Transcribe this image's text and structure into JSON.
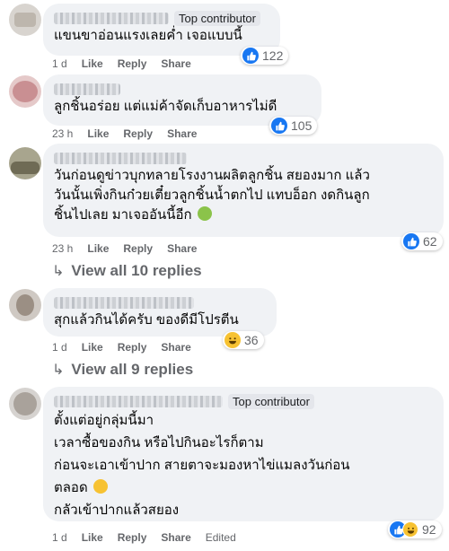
{
  "comments": [
    {
      "badge": "Top contributor",
      "lines": [
        "แขนขาอ่อนแรงเลยค่ำ เจอแบบนี้"
      ],
      "time": "1 d",
      "like": "Like",
      "reply": "Reply",
      "share": "Share",
      "count": "122",
      "reactions": [
        "like"
      ]
    },
    {
      "lines": [
        "ลูกชิ้นอร่อย แต่แม่ค้าจัดเก็บอาหารไม่ดี"
      ],
      "time": "23 h",
      "like": "Like",
      "reply": "Reply",
      "share": "Share",
      "count": "105",
      "reactions": [
        "like"
      ]
    },
    {
      "lines": [
        "วันก่อนดูข่าวบุกทลายโรงงานผลิตลูกชิ้น สยองมาก แล้ว",
        "วันนั้นเพิ่งกินก๋วยเตี๋ยวลูกชิ้นน้ำตกไป แทบอ็อก งดกินลูก",
        "ชิ้นไปเลย มาเจออันนี้อีก"
      ],
      "time": "23 h",
      "like": "Like",
      "reply": "Reply",
      "share": "Share",
      "count": "62",
      "reactions": [
        "like"
      ],
      "view_replies": "View all 10 replies"
    },
    {
      "lines": [
        "สุกแล้วกินได้ครับ ของดีมีโปรตีน"
      ],
      "time": "1 d",
      "like": "Like",
      "reply": "Reply",
      "share": "Share",
      "count": "36",
      "reactions": [
        "haha"
      ],
      "view_replies": "View all 9 replies"
    },
    {
      "badge": "Top contributor",
      "lines": [
        "ตั้งแต่อยู่กลุ่มนี้มา",
        "เวลาซื้อของกิน หรือไปกินอะไรก็ตาม",
        "ก่อนจะเอาเข้าปาก สายตาจะมองหาไข่แมลงวันก่อน",
        "ตลอด",
        "กลัวเข้าปากแล้วสยอง"
      ],
      "time": "1 d",
      "like": "Like",
      "reply": "Reply",
      "share": "Share",
      "edited": "Edited",
      "count": "92",
      "reactions": [
        "like",
        "haha"
      ]
    }
  ],
  "colors": {
    "like_blue": "#1877f2",
    "bubble": "#f0f2f5",
    "meta": "#65676b"
  }
}
